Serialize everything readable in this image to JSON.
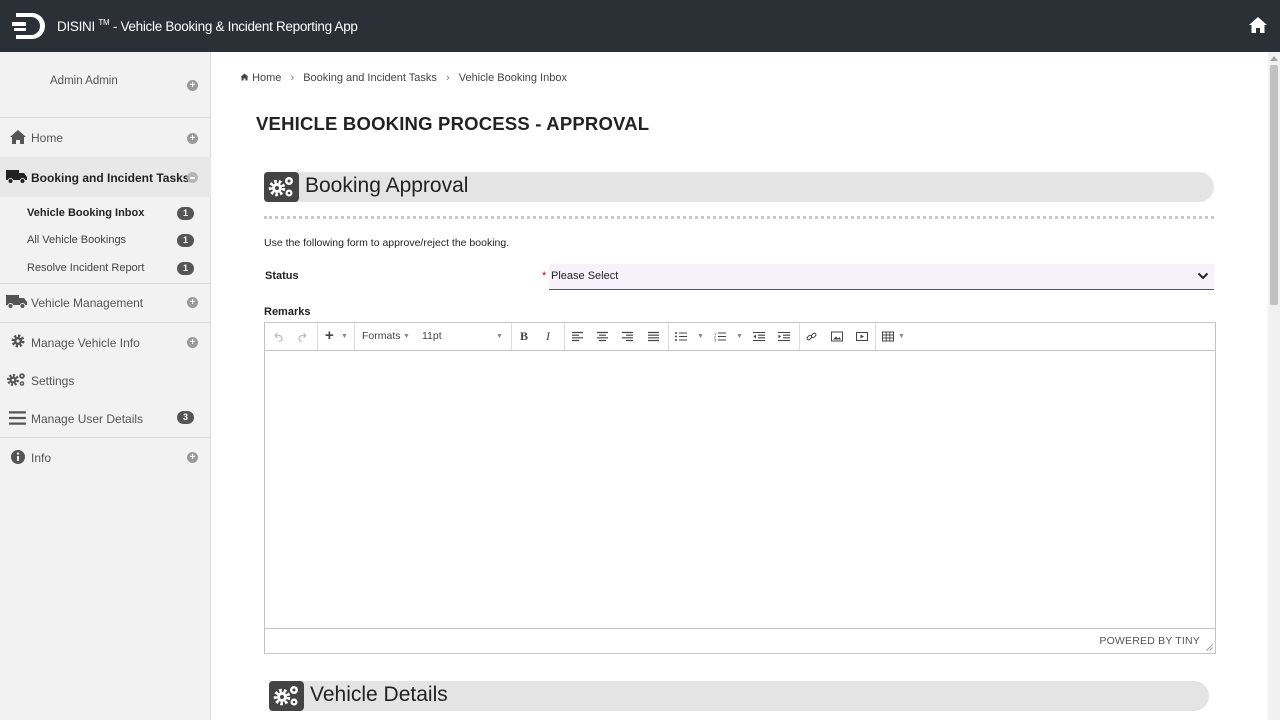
{
  "app": {
    "name": "DISINI",
    "tm": "TM",
    "subtitle": "- Vehicle Booking & Incident Reporting App"
  },
  "sidebar": {
    "user": "Admin Admin",
    "items": [
      {
        "label": "Home",
        "icon": "home-icon"
      },
      {
        "label": "Booking and Incident Tasks",
        "icon": "truck-icon"
      },
      {
        "label": "Vehicle Management",
        "icon": "truck-icon"
      },
      {
        "label": "Manage Vehicle Info",
        "icon": "gear-icon"
      },
      {
        "label": "Settings",
        "icon": "gears-icon"
      },
      {
        "label": "Manage User Details",
        "icon": "menu-icon",
        "badge": "3"
      },
      {
        "label": "Info",
        "icon": "info-icon"
      }
    ],
    "subitems": [
      {
        "label": "Vehicle Booking Inbox",
        "badge": "1"
      },
      {
        "label": "All Vehicle Bookings",
        "badge": "1"
      },
      {
        "label": "Resolve Incident Report",
        "badge": "1"
      }
    ]
  },
  "breadcrumb": {
    "home": "Home",
    "level1": "Booking and Incident Tasks",
    "level2": "Vehicle Booking Inbox"
  },
  "page": {
    "title": "VEHICLE BOOKING PROCESS - APPROVAL"
  },
  "approval": {
    "section_title": "Booking Approval",
    "help_text": "Use the following form to approve/reject the booking.",
    "status_label": "Status",
    "required_mark": "*",
    "status_value": "Please Select",
    "remarks_label": "Remarks"
  },
  "editor": {
    "formats": "Formats",
    "font_size": "11pt",
    "bold": "B",
    "italic": "I",
    "powered_by": "POWERED BY TINY"
  },
  "vehicle": {
    "section_title": "Vehicle Details"
  }
}
